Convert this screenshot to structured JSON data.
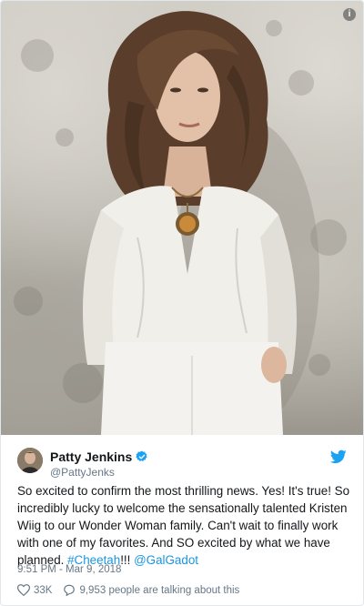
{
  "photo": {
    "alt_icon": "info-icon",
    "info_glyph": "i"
  },
  "tweet": {
    "author": {
      "name": "Patty Jenkins",
      "handle": "@PattyJenks",
      "verified": true,
      "avatar_icon": "avatar"
    },
    "brand_icon": "twitter-bird-icon",
    "text_parts": [
      "So excited to confirm the most thrilling news. Yes! It's true! So incredibly lucky to welcome the sensationally talented Kristen Wiig to our Wonder Woman family. Can't wait to finally work with one of my favorites. And SO excited by what we have planned. ",
      "#Cheetah",
      "!!! ",
      "@GalGadot"
    ],
    "timestamp": "9:51 PM - Mar 9, 2018",
    "likes": "33K",
    "conversation": "9,953 people are talking about this"
  },
  "colors": {
    "link": "#1b95e0",
    "secondary_text": "#657786",
    "verified": "#1da1f2"
  }
}
